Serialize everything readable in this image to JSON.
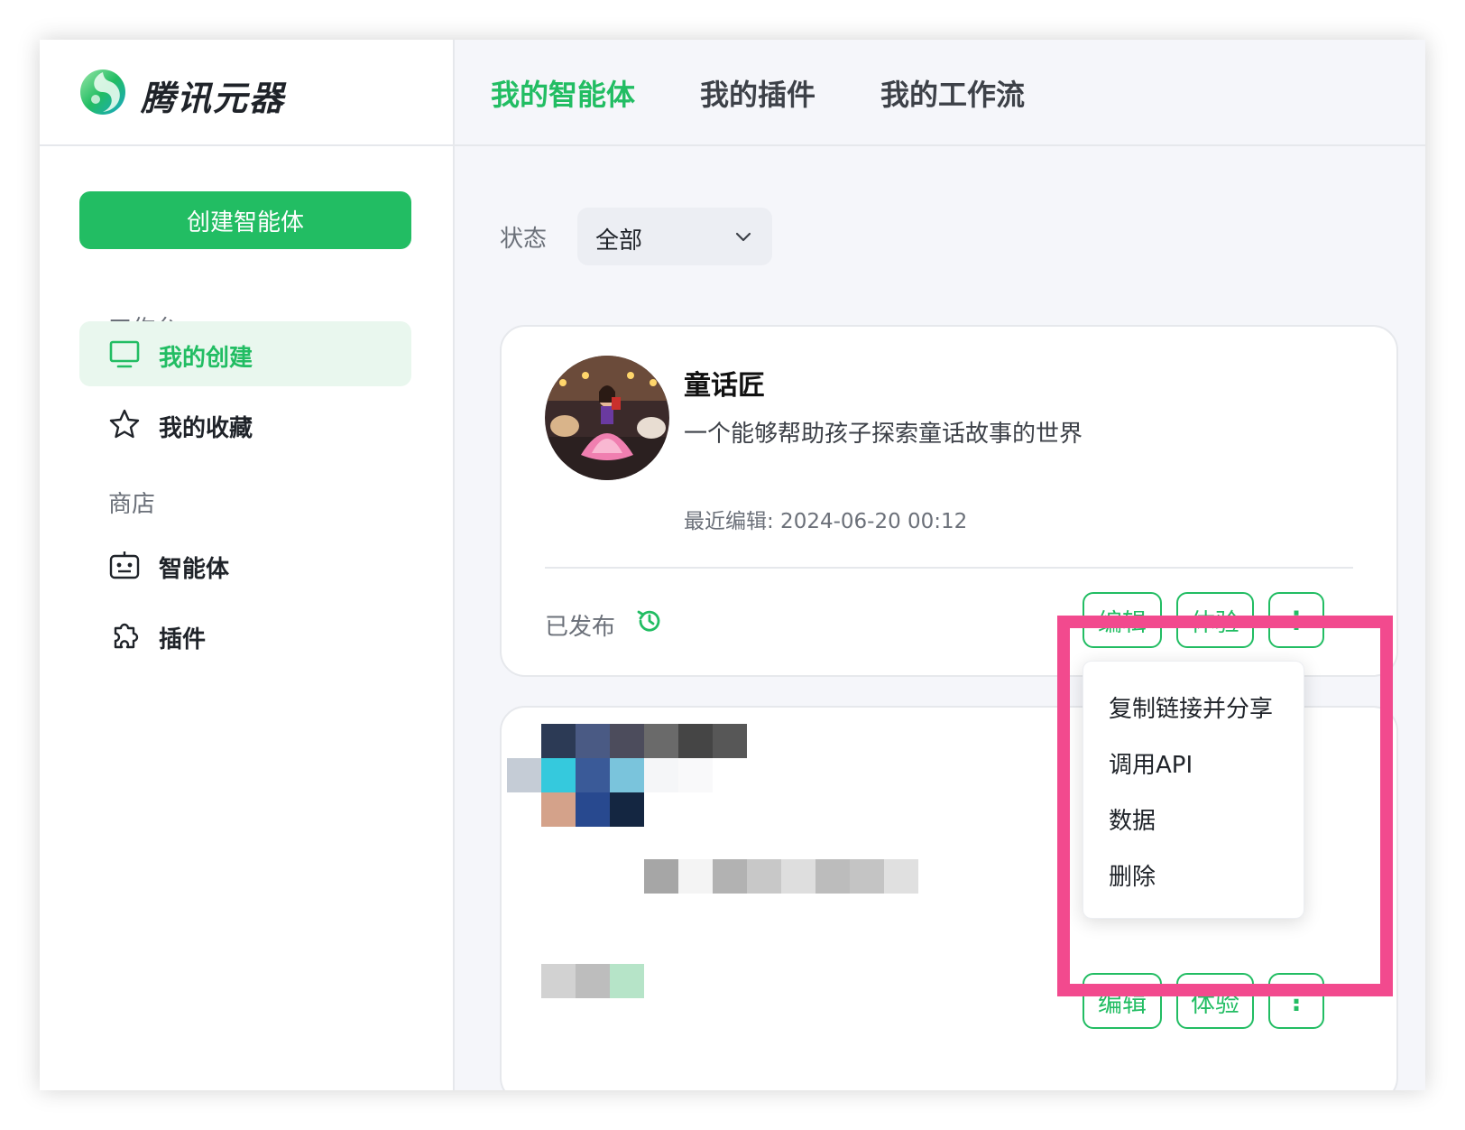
{
  "app": {
    "name": "腾讯元器"
  },
  "sidebar": {
    "create_label": "创建智能体",
    "workspace_title": "工作台",
    "items": [
      {
        "label": "我的创建",
        "icon": "monitor-icon",
        "active": true
      },
      {
        "label": "我的收藏",
        "icon": "star-icon",
        "active": false
      }
    ],
    "store_title": "商店",
    "store_items": [
      {
        "label": "智能体",
        "icon": "robot-icon"
      },
      {
        "label": "插件",
        "icon": "puzzle-icon"
      }
    ]
  },
  "tabs": [
    {
      "label": "我的智能体",
      "active": true
    },
    {
      "label": "我的插件",
      "active": false
    },
    {
      "label": "我的工作流",
      "active": false
    }
  ],
  "filter": {
    "label": "状态",
    "value": "全部"
  },
  "cards": [
    {
      "title": "童话匠",
      "description": "一个能够帮助孩子探索童话故事的世界",
      "last_edit": "最近编辑: 2024-06-20 00:12",
      "status": "已发布",
      "edit_label": "编辑",
      "try_label": "体验",
      "more_label": "⋮"
    },
    {
      "edit_label": "编辑",
      "try_label": "体验",
      "more_label": "⋮"
    }
  ],
  "more_menu": {
    "items": [
      "复制链接并分享",
      "调用API",
      "数据",
      "删除"
    ]
  },
  "colors": {
    "accent": "#22bd63",
    "highlight": "#f24a8e"
  }
}
